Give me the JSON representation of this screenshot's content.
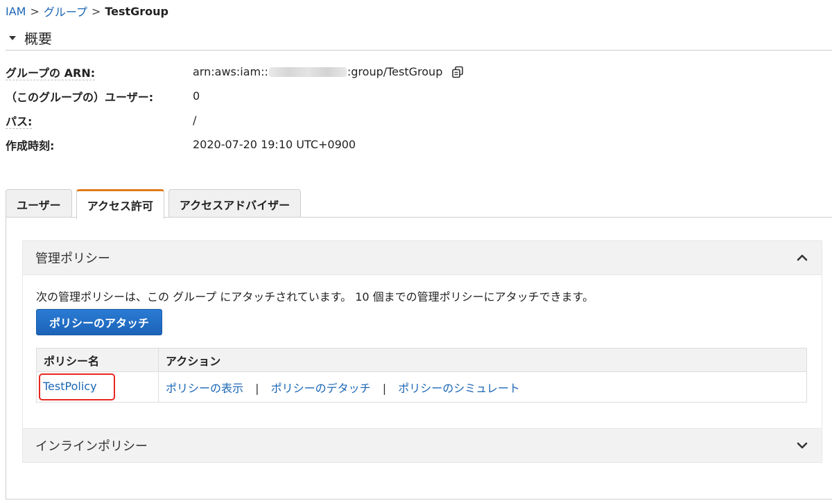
{
  "breadcrumb": {
    "items": [
      "IAM",
      "グループ"
    ],
    "separator": ">",
    "current": "TestGroup"
  },
  "summary": {
    "title": "概要",
    "rows": [
      {
        "label": "グループの ARN:",
        "value_prefix": "arn:aws:iam::",
        "value_suffix": ":group/TestGroup"
      },
      {
        "label": "（このグループの）ユーザー:",
        "value": "0"
      },
      {
        "label": "パス:",
        "value": "/"
      },
      {
        "label": "作成時刻:",
        "value": "2020-07-20 19:10 UTC+0900"
      }
    ]
  },
  "tabs": [
    {
      "label": "ユーザー",
      "active": false
    },
    {
      "label": "アクセス許可",
      "active": true
    },
    {
      "label": "アクセスアドバイザー",
      "active": false
    }
  ],
  "managed_policies": {
    "title": "管理ポリシー",
    "description": "次の管理ポリシーは、この グループ にアタッチされています。 10 個までの管理ポリシーにアタッチできます。",
    "attach_button": "ポリシーのアタッチ",
    "table": {
      "headers": [
        "ポリシー名",
        "アクション"
      ],
      "rows": [
        {
          "name": "TestPolicy",
          "actions": [
            "ポリシーの表示",
            "ポリシーのデタッチ",
            "ポリシーのシミュレート"
          ]
        }
      ],
      "action_separator": "|"
    }
  },
  "inline_policies": {
    "title": "インラインポリシー"
  },
  "colors": {
    "link": "#1a66b5",
    "active_tab_accent": "#e07b1a",
    "primary_button": "#1c63b8",
    "highlight_box": "#e8261e"
  },
  "icons": {
    "summary_toggle": "caret-down-icon",
    "copy": "copy-icon",
    "managed_toggle": "chevron-up-icon",
    "inline_toggle": "chevron-down-icon"
  }
}
